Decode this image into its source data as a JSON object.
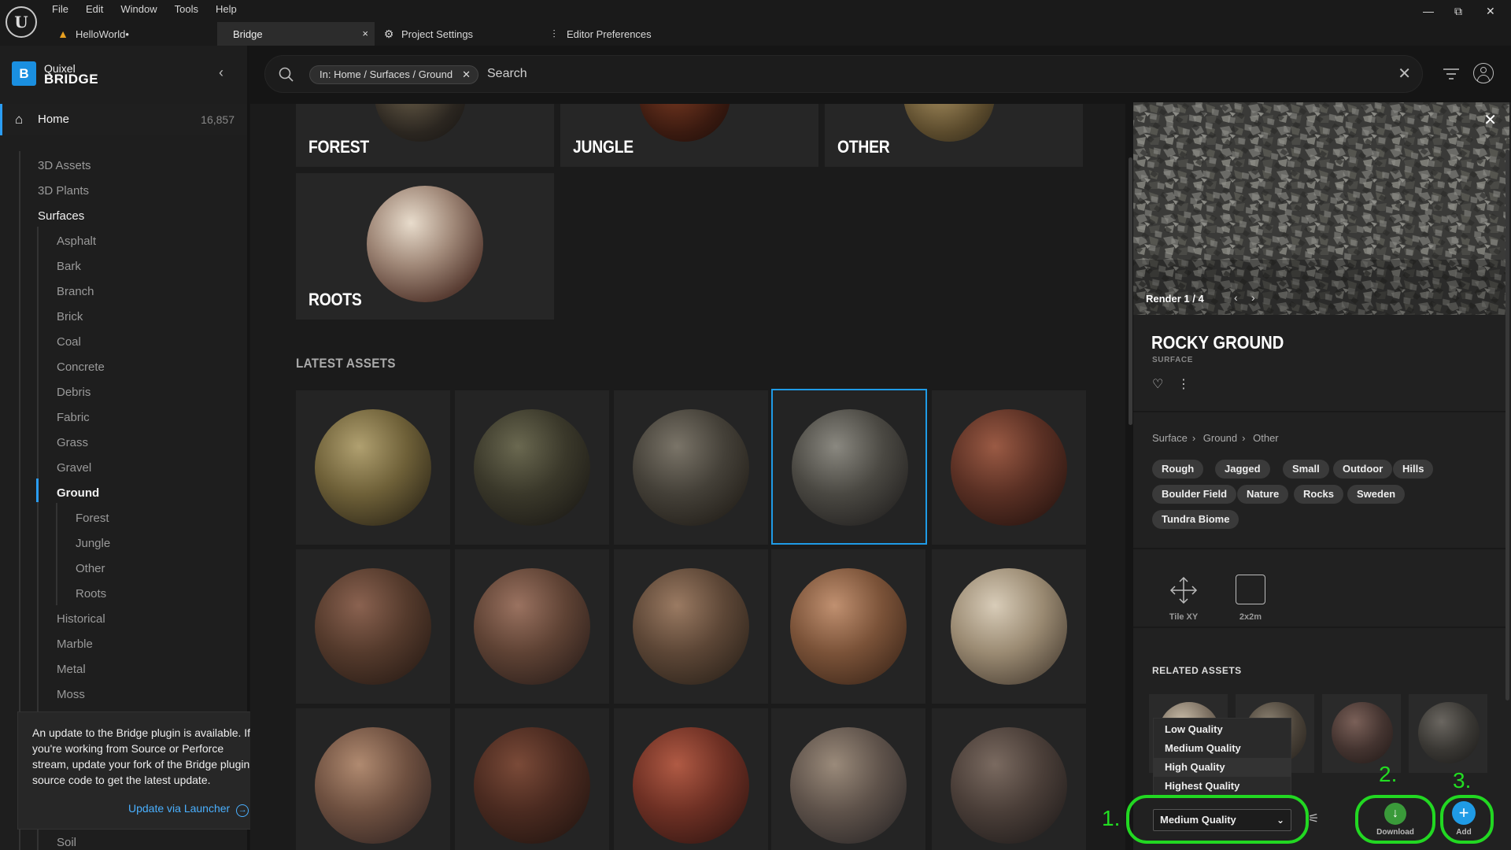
{
  "menu": [
    "File",
    "Edit",
    "Window",
    "Tools",
    "Help"
  ],
  "tabs": [
    {
      "label": "HelloWorld•"
    },
    {
      "label": "Bridge",
      "close": "×"
    },
    {
      "label": "Project Settings"
    },
    {
      "label": "Editor Preferences"
    }
  ],
  "window_controls": {
    "minimize": "—",
    "restore": "⧉",
    "close": "✕"
  },
  "brand": {
    "logo": "B",
    "line1": "Quixel",
    "line2": "BRIDGE"
  },
  "sidebar": {
    "home_label": "Home",
    "home_count": "16,857",
    "items": [
      "3D Assets",
      "3D Plants",
      "Surfaces",
      "Asphalt",
      "Bark",
      "Branch",
      "Brick",
      "Coal",
      "Concrete",
      "Debris",
      "Fabric",
      "Grass",
      "Gravel",
      "Ground",
      "Forest",
      "Jungle",
      "Other",
      "Roots",
      "Historical",
      "Marble",
      "Metal",
      "Moss",
      "Soil"
    ]
  },
  "toast": {
    "message": "An update to the Bridge plugin is available. If you're working from Source or Perforce stream, update your fork of the Bridge plugin source code to get the latest update.",
    "link": "Update via Launcher",
    "close": "×"
  },
  "search": {
    "chip": "In: Home / Surfaces / Ground",
    "placeholder": "Search",
    "clear": "✕"
  },
  "categories": [
    "FOREST",
    "JUNGLE",
    "OTHER",
    "ROOTS"
  ],
  "latest_title": "LATEST ASSETS",
  "detail": {
    "render_label": "Render 1 / 4",
    "title": "ROCKY GROUND",
    "type": "SURFACE",
    "breadcrumb": [
      "Surface",
      "Ground",
      "Other"
    ],
    "tags": [
      "Rough",
      "Jagged",
      "Small",
      "Outdoor",
      "Hills",
      "Boulder Field",
      "Nature",
      "Rocks",
      "Sweden",
      "Tundra Biome"
    ],
    "attributes": [
      {
        "label": "Tile XY"
      },
      {
        "label": "2x2m"
      }
    ],
    "related_title": "RELATED ASSETS"
  },
  "quality": {
    "options": [
      "Low Quality",
      "Medium Quality",
      "High Quality",
      "Highest Quality"
    ],
    "selected": "Medium Quality",
    "download_label": "Download",
    "add_label": "Add"
  },
  "annotations": [
    "1.",
    "2.",
    "3."
  ],
  "colors": {
    "accent": "#1f9be6",
    "annotation": "#22d822",
    "link": "#4ab0ff"
  }
}
